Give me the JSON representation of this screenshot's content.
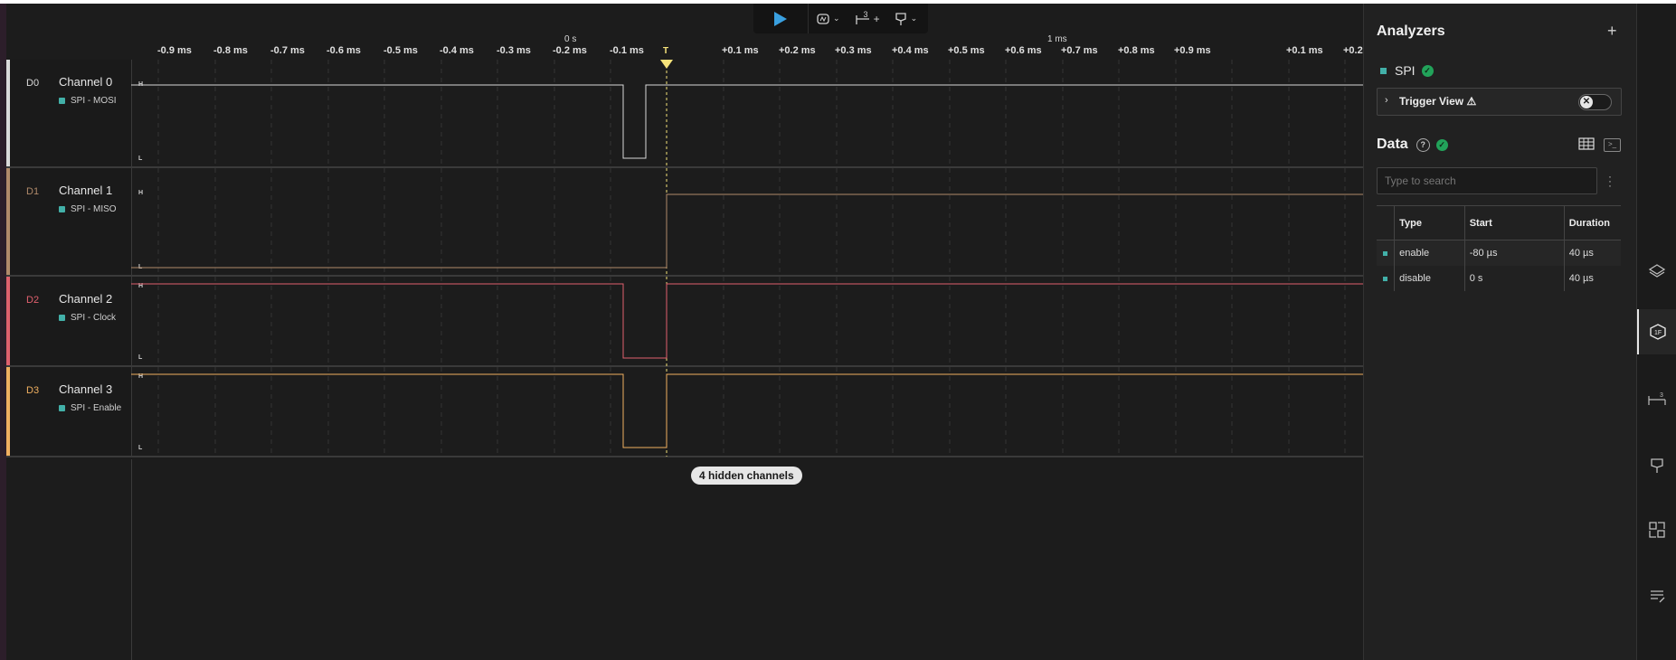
{
  "toolbar": {
    "play_icon": "play-icon",
    "trigger_icon": "trigger-icon",
    "timing_icon": "timing-marker-icon",
    "timing_count": "3",
    "marker_icon": "marker-icon"
  },
  "ruler": {
    "zero_label": "0 s",
    "trigger_label": "T",
    "one_ms_label": "1 ms",
    "ticks": [
      "-0.9 ms",
      "-0.8 ms",
      "-0.7 ms",
      "-0.6 ms",
      "-0.5 ms",
      "-0.4 ms",
      "-0.3 ms",
      "-0.2 ms",
      "-0.1 ms",
      "+0.1 ms",
      "+0.2 ms",
      "+0.3 ms",
      "+0.4 ms",
      "+0.5 ms",
      "+0.6 ms",
      "+0.7 ms",
      "+0.8 ms",
      "+0.9 ms",
      "+0.1 ms",
      "+0.2"
    ]
  },
  "channels": [
    {
      "id": "D0",
      "name": "Channel 0",
      "analyzer": "SPI - MOSI",
      "color": "#d9d9d9",
      "high": "H",
      "low": "L"
    },
    {
      "id": "D1",
      "name": "Channel 1",
      "analyzer": "SPI - MISO",
      "color": "#b08a6a",
      "high": "H",
      "low": "L"
    },
    {
      "id": "D2",
      "name": "Channel 2",
      "analyzer": "SPI - Clock",
      "color": "#e0606e",
      "high": "H",
      "low": "L"
    },
    {
      "id": "D3",
      "name": "Channel 3",
      "analyzer": "SPI - Enable",
      "color": "#f0b060",
      "high": "H",
      "low": "L"
    }
  ],
  "hidden_channels_label": "4 hidden channels",
  "analyzers": {
    "title": "Analyzers",
    "add_label": "+",
    "items": [
      {
        "name": "SPI",
        "status": "✓"
      }
    ],
    "trigger_view": {
      "label": "Trigger View",
      "warning": "⚠",
      "toggle": "✕"
    }
  },
  "data_panel": {
    "title": "Data",
    "help": "?",
    "status": "✓",
    "search_placeholder": "Type to search",
    "columns": [
      "Type",
      "Start",
      "Duration"
    ],
    "rows": [
      {
        "type": "enable",
        "start": "-80 µs",
        "duration": "40 µs"
      },
      {
        "type": "disable",
        "start": "0 s",
        "duration": "40 µs"
      }
    ]
  },
  "side_rail": [
    "layers-icon",
    "analyzer-icon",
    "timing-icon",
    "marker-icon",
    "extensions-icon",
    "notes-icon"
  ],
  "colors": {
    "accent": "#3aa0e0",
    "trigger": "#f5e27a",
    "analyzer_dot": "#42b0a8",
    "ok": "#22a35a"
  }
}
